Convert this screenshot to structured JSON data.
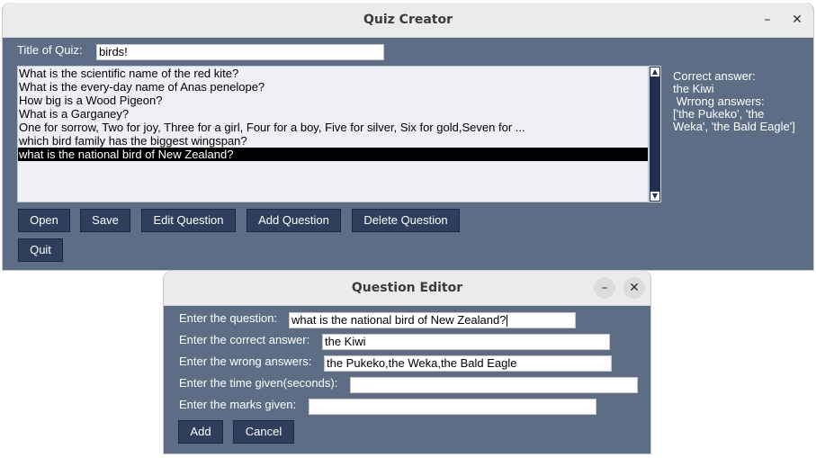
{
  "main_window": {
    "title": "Quiz Creator",
    "minimize_glyph": "–",
    "close_glyph": "✕",
    "quiz_title_label": "Title of Quiz:",
    "quiz_title_value": "birds!",
    "questions": [
      "What is the scientific name of the red kite?",
      "What is the every-day name of Anas penelope?",
      "How big is a Wood Pigeon?",
      "What is a Garganey?",
      "One for sorrow, Two for joy, Three for a girl, Four for a boy, Five for silver, Six for gold,Seven for ...",
      "which bird family has the biggest wingspan?",
      "what is the national bird of New Zealand?"
    ],
    "selected_index": 6,
    "answer_info": {
      "line1": "Correct answer:",
      "line2": "the Kiwi",
      "line3": " Wrrong answers:",
      "line4": "['the Pukeko', 'the",
      "line5": "Weka', 'the Bald Eagle']"
    },
    "buttons": {
      "open": "Open",
      "save": "Save",
      "edit_question": "Edit Question",
      "add_question": "Add Question",
      "delete_question": "Delete Question",
      "quit": "Quit"
    }
  },
  "editor_window": {
    "title": "Question Editor",
    "minimize_glyph": "–",
    "close_glyph": "✕",
    "question_label": "Enter the question:",
    "question_value": "what is the national bird of New Zealand?",
    "correct_label": "Enter the correct answer:",
    "correct_value": "the Kiwi",
    "wrong_label": "Enter the wrong answers:",
    "wrong_value": "the Pukeko,the Weka,the Bald Eagle",
    "time_label": "Enter the time given(seconds):",
    "time_value": "",
    "marks_label": "Enter the marks given:",
    "marks_value": "",
    "add_label": "Add",
    "cancel_label": "Cancel"
  }
}
